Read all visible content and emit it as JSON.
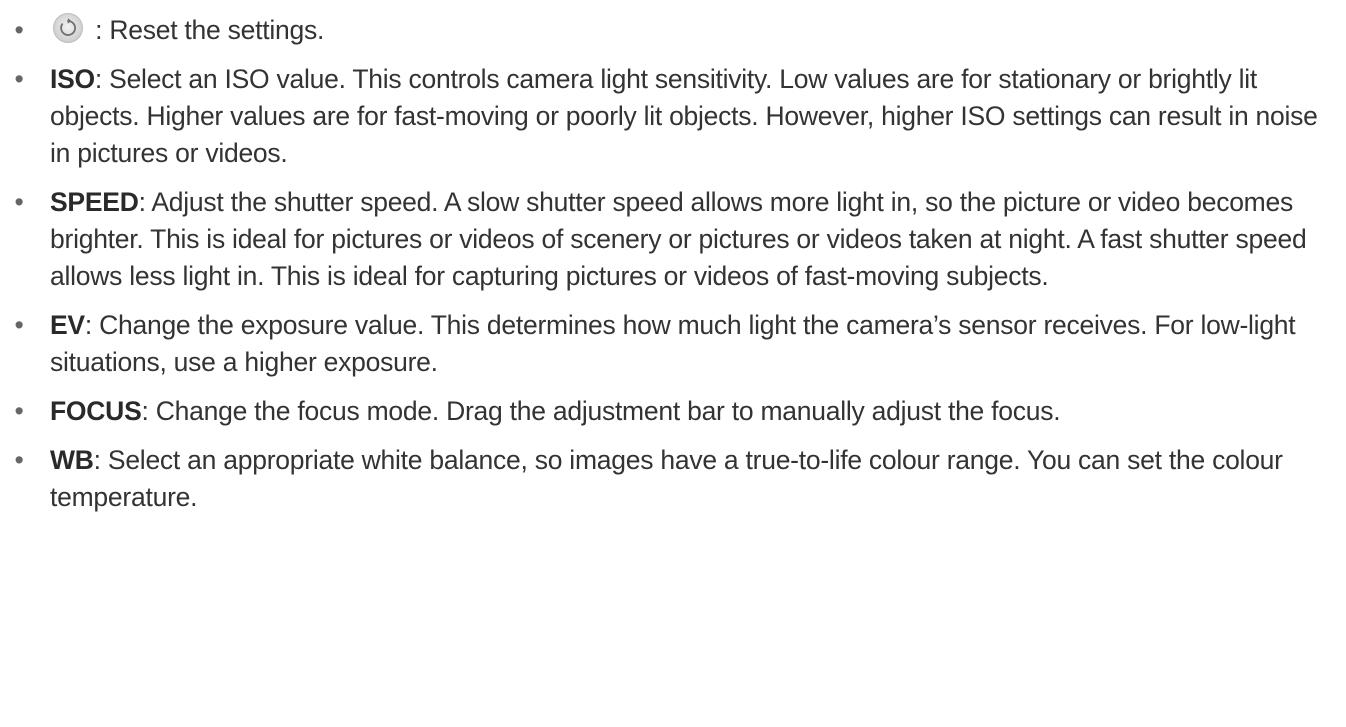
{
  "items": [
    {
      "icon": "reset-icon",
      "term": "",
      "separator": " : ",
      "text": "Reset the settings."
    },
    {
      "term": "ISO",
      "separator": ": ",
      "text": "Select an ISO value. This controls camera light sensitivity. Low values are for stationary or brightly lit objects. Higher values are for fast-moving or poorly lit objects. However, higher ISO settings can result in noise in pictures or videos."
    },
    {
      "term": "SPEED",
      "separator": ": ",
      "text": "Adjust the shutter speed. A slow shutter speed allows more light in, so the picture or video becomes brighter. This is ideal for pictures or videos of scenery or pictures or videos taken at night. A fast shutter speed allows less light in. This is ideal for capturing pictures or videos of fast-moving subjects."
    },
    {
      "term": "EV",
      "separator": ": ",
      "text": "Change the exposure value. This determines how much light the camera’s sensor receives. For low-light situations, use a higher exposure."
    },
    {
      "term": "FOCUS",
      "separator": ": ",
      "text": "Change the focus mode. Drag the adjustment bar to manually adjust the focus."
    },
    {
      "term": "WB",
      "separator": ": ",
      "text": "Select an appropriate white balance, so images have a true-to-life colour range. You can set the colour temperature."
    }
  ],
  "bullet_glyph": "•"
}
